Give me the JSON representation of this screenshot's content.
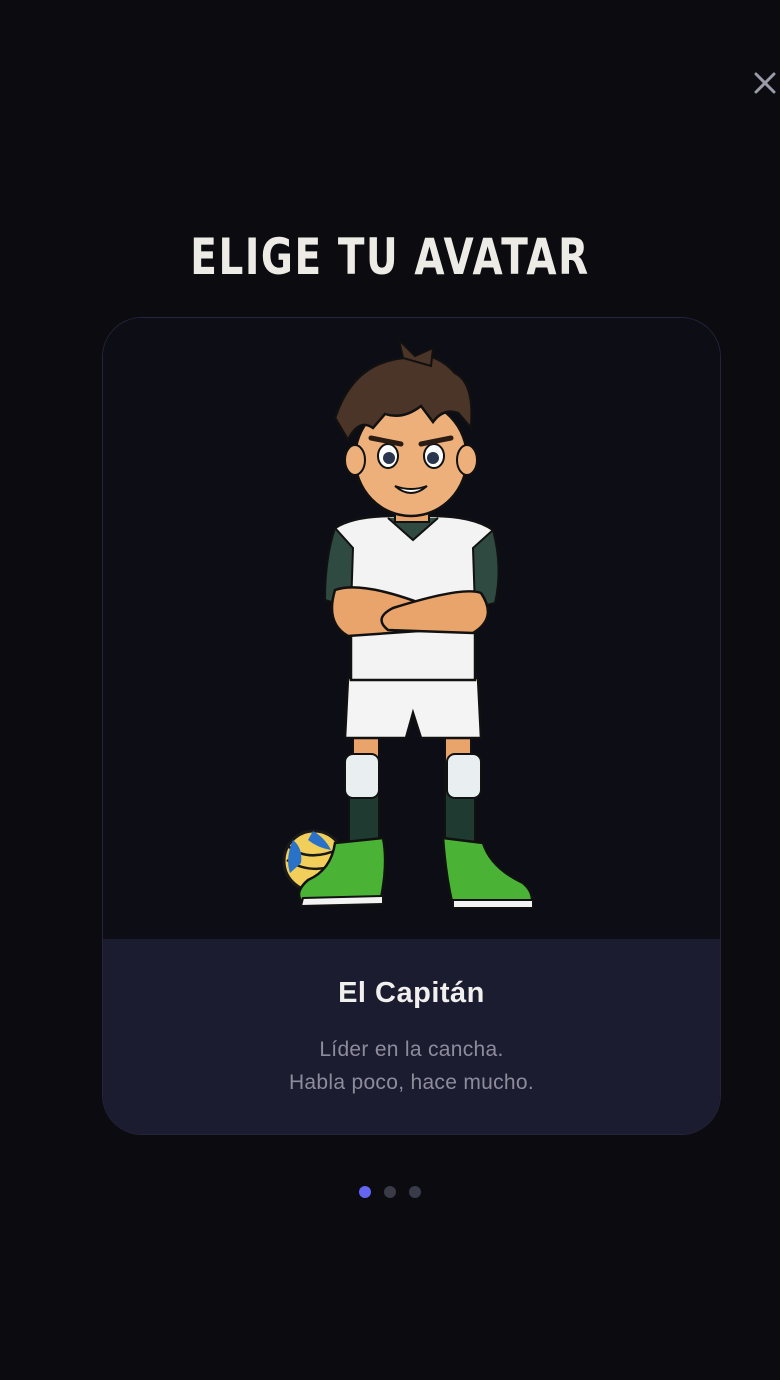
{
  "screen": {
    "title": "ELIGE TU AVATAR",
    "close_icon": "close-icon"
  },
  "avatar": {
    "name": "El Capitán",
    "description_line1": "Líder en la cancha.",
    "description_line2": "Habla poco, hace mucho.",
    "illustration": "volleyball-player-arms-crossed"
  },
  "pagination": {
    "total": 3,
    "active_index": 0
  },
  "colors": {
    "background": "#0b0b10",
    "card_background": "#0d0d16",
    "info_panel": "#1b1c30",
    "accent_dot": "#6366f1"
  }
}
